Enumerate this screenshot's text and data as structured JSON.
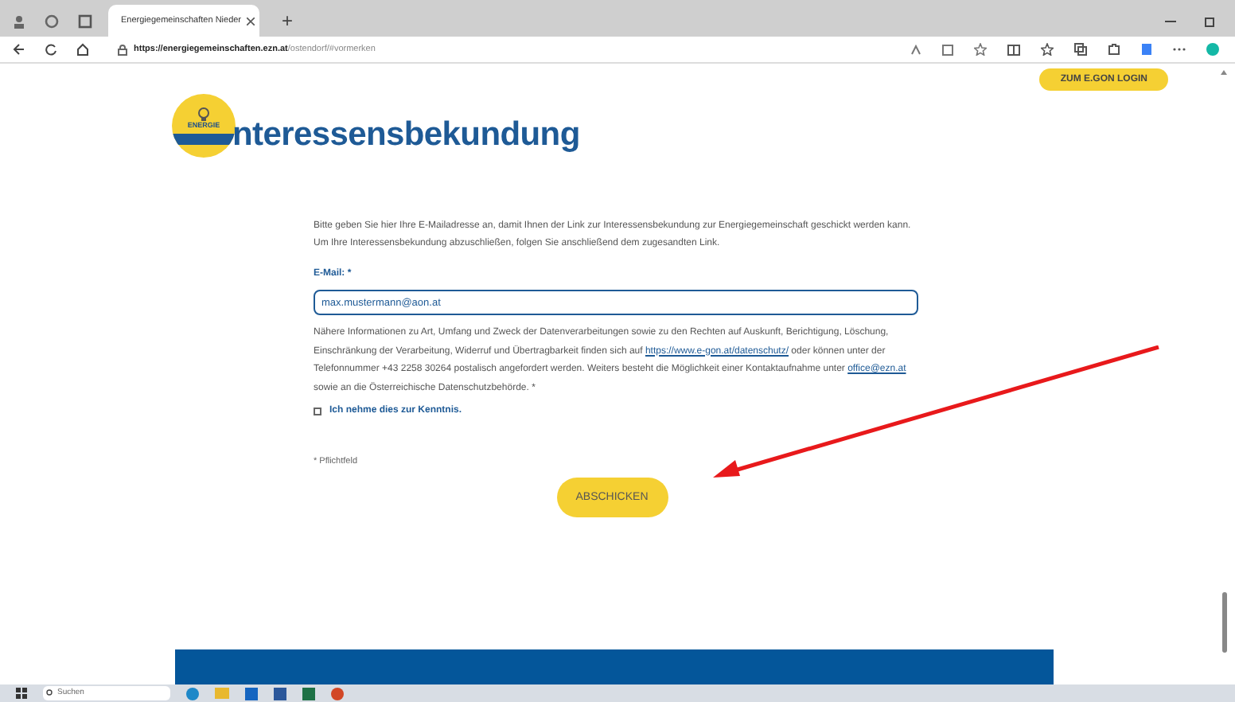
{
  "browser": {
    "tabs": [
      {
        "title": "Energiegemeinschaften Nieder",
        "selected": true
      }
    ],
    "new_tab": "+",
    "url_host": "https://energiegemeinschaften.ezn.at",
    "url_path": "/ostendorf/#vormerken"
  },
  "header": {
    "login_button": "ZUM E.GON LOGIN",
    "logo_text": "ENERGIE",
    "heading": "nteressensbekundung"
  },
  "form": {
    "intro": "Bitte geben Sie hier Ihre E-Mailadresse an, damit Ihnen der Link zur Interessensbekundung zur Energiegemeinschaft geschickt werden kann. Um Ihre Interessensbekundung abzuschließen, folgen Sie anschließend dem zugesandten Link.",
    "email_label": "E-Mail: *",
    "email_value": "max.mustermann@aon.at",
    "privacy": [
      {
        "kind": "text",
        "text": "Nähere Informationen zu Art, Umfang und Zweck der Datenverarbeitungen sowie zu den Rechten auf Auskunft, Berichtigung, Löschung, Einschränkung der Verarbeitung, Widerruf und Übertragbarkeit finden sich auf "
      },
      {
        "kind": "link",
        "text": "https://www.e-gon.at/datenschutz/"
      },
      {
        "kind": "text",
        "text": " oder können unter der Telefonnummer +43 2258 30264 postalisch angefordert werden. Weiters besteht die Möglichkeit einer Kontaktaufnahme unter "
      },
      {
        "kind": "link",
        "text": "office@ezn.at"
      },
      {
        "kind": "text",
        "text": " sowie an die Österreichische Datenschutzbehörde. *"
      }
    ],
    "consent": {
      "label": "Ich nehme dies zur Kenntnis.",
      "checked": false
    },
    "required_note": "* Pflichtfeld",
    "submit": "ABSCHICKEN"
  },
  "taskbar": {
    "search_placeholder": "Suchen"
  }
}
